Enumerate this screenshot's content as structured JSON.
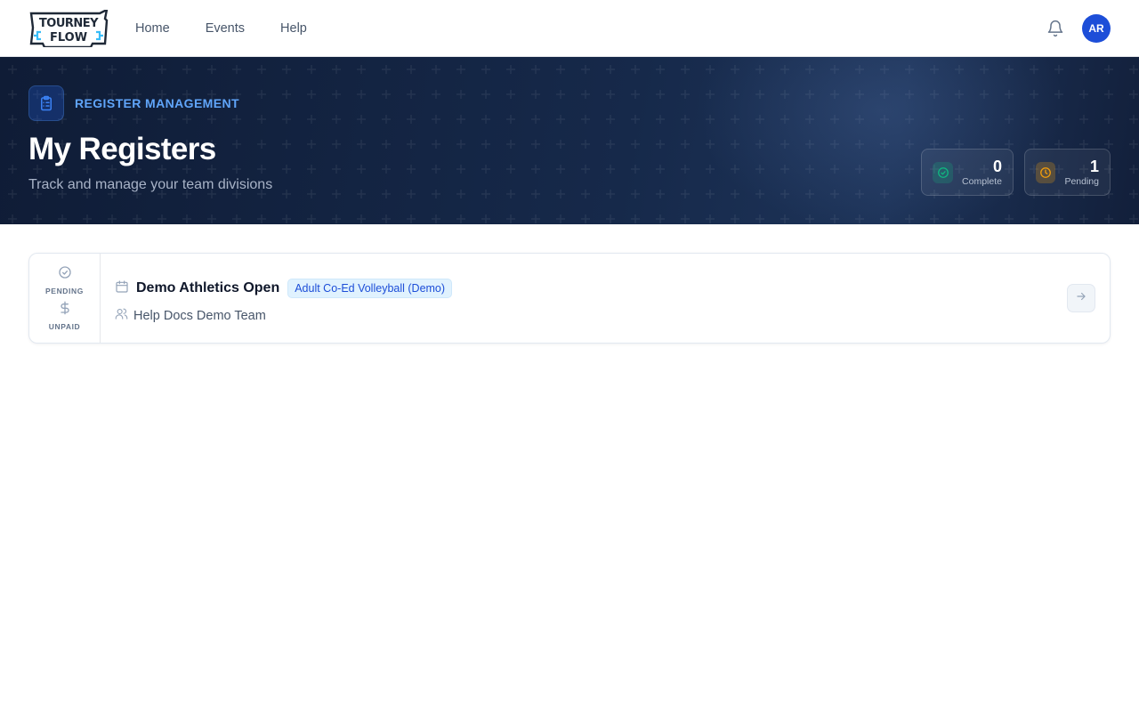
{
  "app": {
    "logo_alt": "TOURNEY FLOW"
  },
  "nav": {
    "items": [
      {
        "label": "Home"
      },
      {
        "label": "Events"
      },
      {
        "label": "Help"
      }
    ],
    "notifications_icon": "bell-icon",
    "avatar_initials": "AR"
  },
  "hero": {
    "eyebrow": "REGISTER MANAGEMENT",
    "eyebrow_icon": "clipboard-list-icon",
    "title": "My Registers",
    "subtitle": "Track and manage your team divisions",
    "stats": [
      {
        "value": "0",
        "label": "Complete",
        "icon": "check-circle-icon",
        "color": "#10b981"
      },
      {
        "value": "1",
        "label": "Pending",
        "icon": "clock-icon",
        "color": "#f59e0b"
      }
    ]
  },
  "registers": [
    {
      "status_label": "PENDING",
      "status_icon": "check-circle-icon",
      "payment_label": "UNPAID",
      "payment_icon": "dollar-icon",
      "event_name": "Demo Athletics Open",
      "event_icon": "calendar-icon",
      "division": "Adult Co-Ed Volleyball (Demo)",
      "team_name": "Help Docs Demo Team",
      "team_icon": "users-icon",
      "action_icon": "arrow-right-icon"
    }
  ],
  "colors": {
    "brand": "#1d4ed8",
    "accent": "#60a5fa",
    "hero_bg": "#13223f"
  }
}
